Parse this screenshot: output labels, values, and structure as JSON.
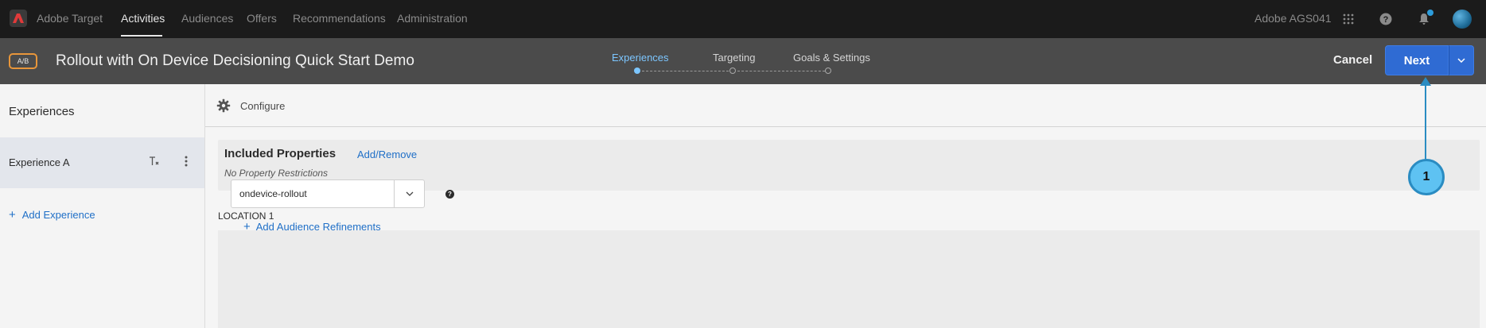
{
  "topnav": {
    "app_name": "Adobe Target",
    "items": [
      "Activities",
      "Audiences",
      "Offers",
      "Recommendations",
      "Administration"
    ],
    "active_item": "Activities",
    "org": "Adobe AGS041",
    "icons": [
      "apps-grid-icon",
      "help-icon",
      "bell-icon",
      "avatar"
    ]
  },
  "activity": {
    "type_badge": "A/B",
    "title": "Rollout with On Device Decisioning Quick Start Demo",
    "steps": [
      {
        "label": "Experiences",
        "active": true
      },
      {
        "label": "Targeting",
        "active": false
      },
      {
        "label": "Goals & Settings",
        "active": false
      }
    ],
    "cancel_label": "Cancel",
    "next_label": "Next"
  },
  "sidebar": {
    "title": "Experiences",
    "experiences": [
      {
        "label": "Experience A"
      }
    ],
    "add_experience_label": "Add Experience"
  },
  "main": {
    "configure_label": "Configure",
    "included_properties_title": "Included Properties",
    "add_remove_label": "Add/Remove",
    "no_restrictions_text": "No Property Restrictions",
    "location_title": "LOCATION 1",
    "location_select_value": "ondevice-rollout",
    "add_audience_label": "Add Audience Refinements"
  },
  "callout": {
    "number": "1"
  },
  "colors": {
    "topnav_bg": "#1b1b1b",
    "header_bg": "#4b4b4b",
    "accent_blue": "#2f6bd3",
    "link_blue": "#1f6fc7",
    "active_step": "#7cc6ff",
    "ab_badge_border": "#e8963a",
    "callout_fill": "#5ec2f2"
  }
}
